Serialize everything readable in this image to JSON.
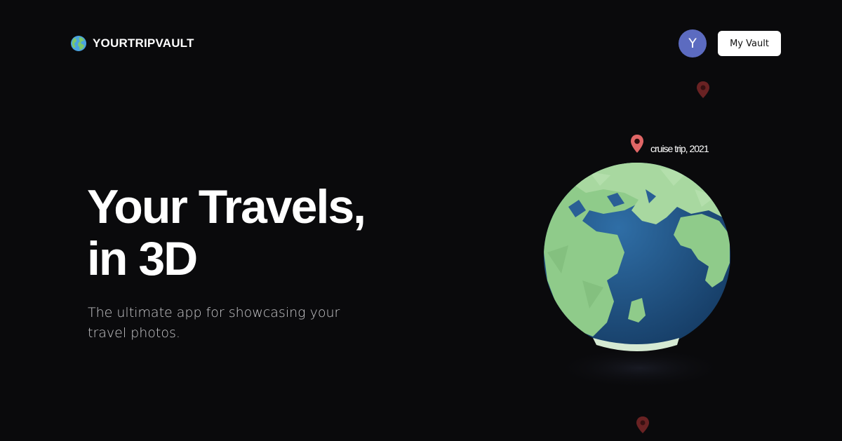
{
  "header": {
    "brand_name": "YOURTRIPVAULT",
    "brand_icon": "globe-icon",
    "avatar_initial": "Y",
    "vault_button_label": "My Vault"
  },
  "hero": {
    "title_line1": "Your Travels,",
    "title_line2": "in 3D",
    "subtitle": "The ultimate app for showcasing your travel photos."
  },
  "globe": {
    "pins": [
      {
        "icon": "map-pin-icon",
        "label": ""
      },
      {
        "icon": "map-pin-icon",
        "label": "cruise trip, 2021"
      },
      {
        "icon": "map-pin-icon",
        "label": ""
      }
    ]
  },
  "colors": {
    "background": "#0a0a0c",
    "avatar": "#5c6bc0",
    "land": "#8fcb8a",
    "ocean": "#1e4f82",
    "pin": "#e06666"
  }
}
